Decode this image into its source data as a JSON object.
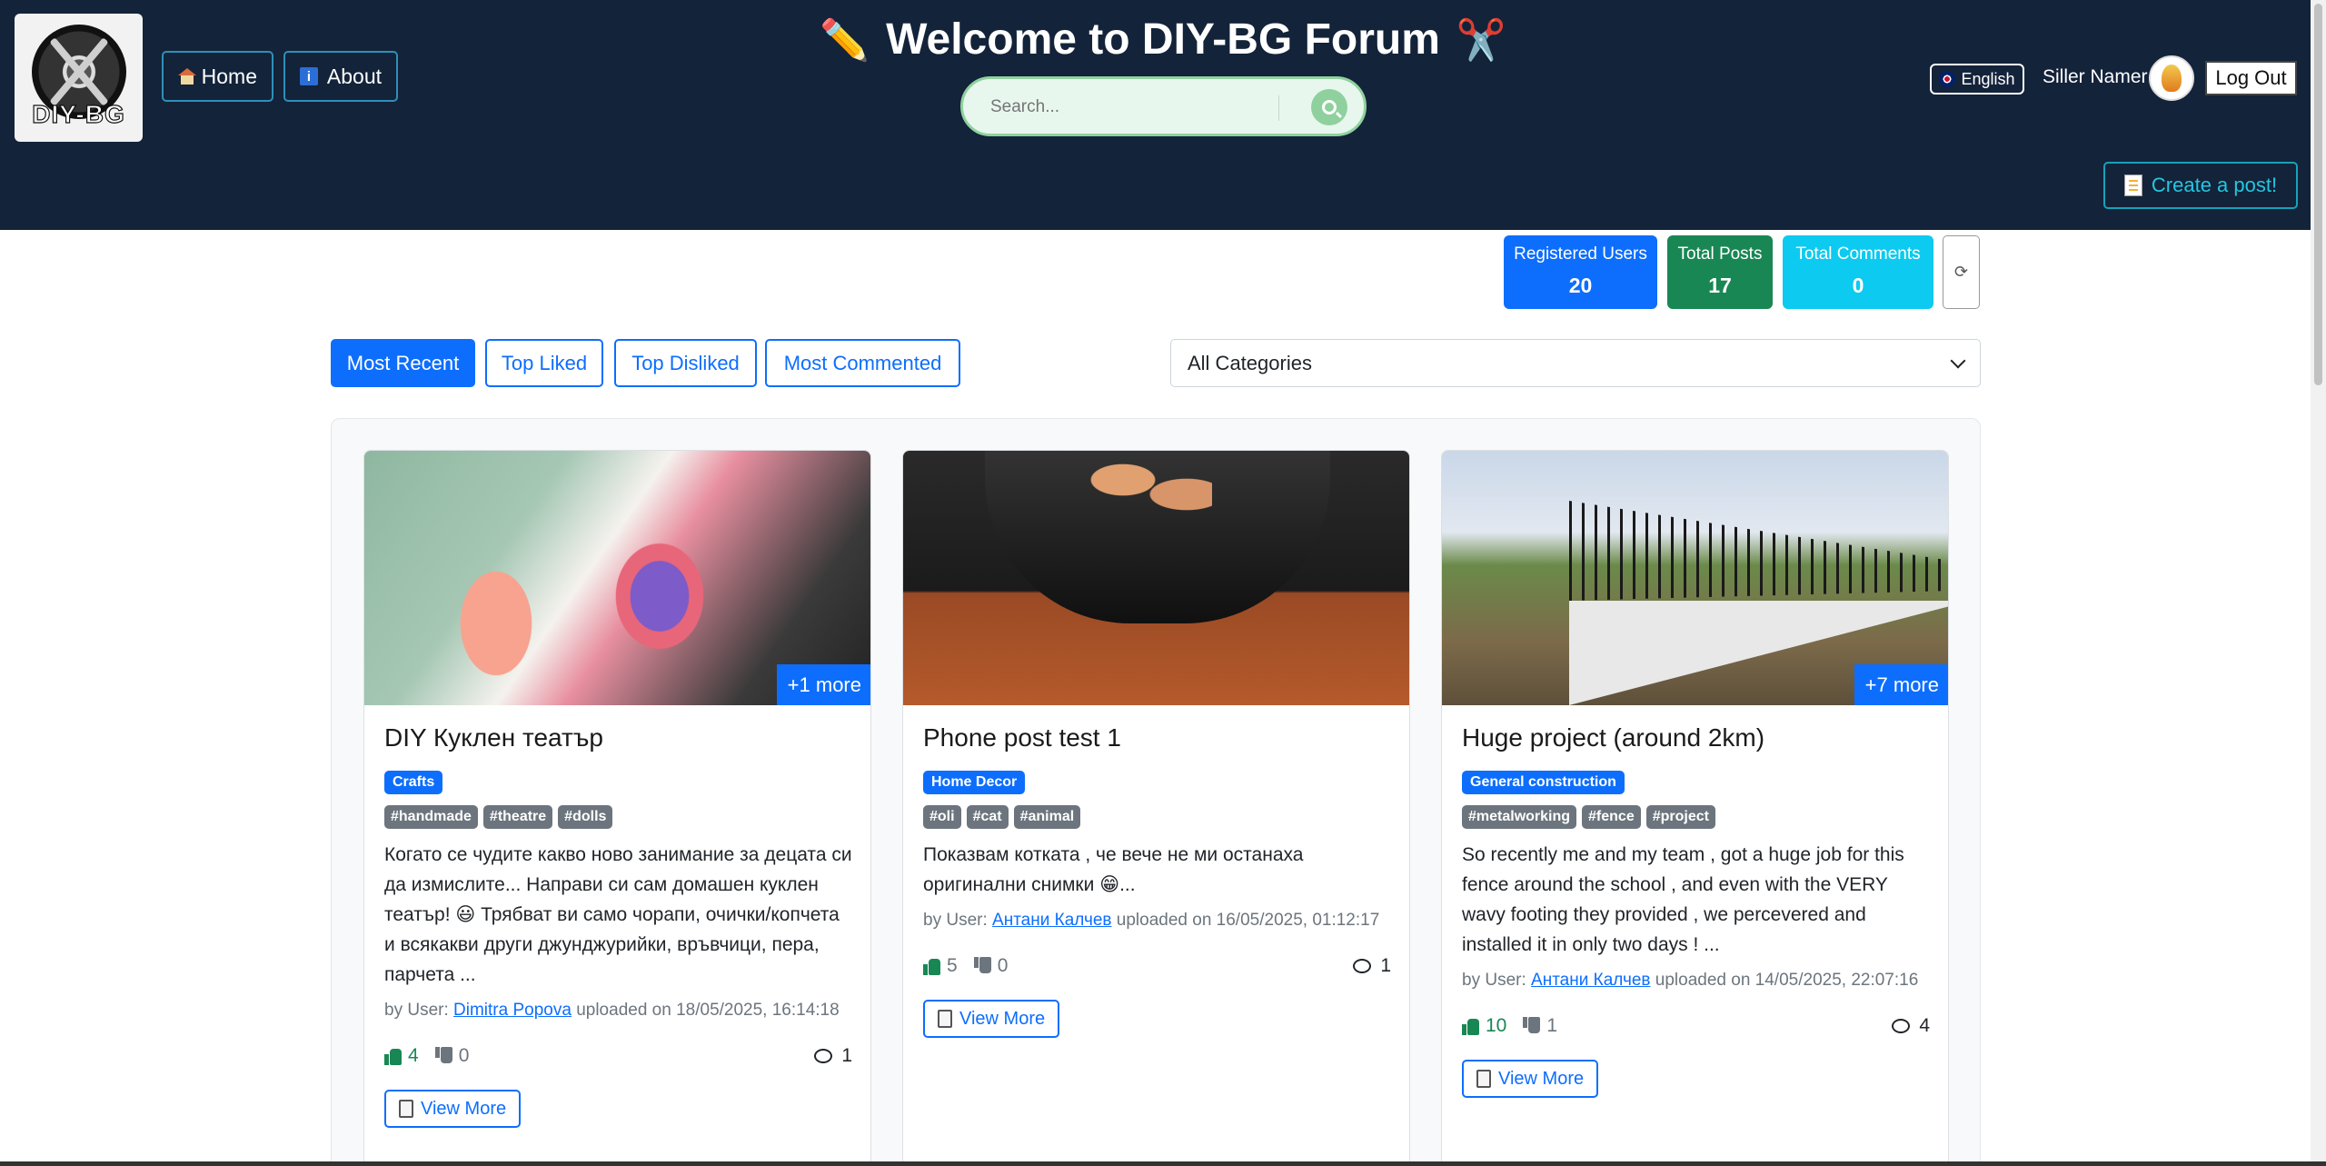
{
  "header": {
    "logo_text": "DIY-BG",
    "title": "Welcome to DIY-BG Forum",
    "title_left_icon": "✏️",
    "title_right_icon": "✂️",
    "nav": [
      {
        "label": "Home",
        "icon": "house-icon"
      },
      {
        "label": "About",
        "icon": "info-icon"
      }
    ],
    "search": {
      "placeholder": "Search..."
    },
    "language": "English",
    "username": "Siller Namer",
    "logout_label": "Log Out",
    "create_post_label": "Create a post!"
  },
  "stats": {
    "users_label": "Registered Users",
    "users_value": "20",
    "posts_label": "Total Posts",
    "posts_value": "17",
    "comments_label": "Total Comments",
    "comments_value": "0",
    "refresh_glyph": "⟳"
  },
  "filters": {
    "tabs": [
      "Most Recent",
      "Top Liked",
      "Top Disliked",
      "Most Commented"
    ],
    "active_tab": "Most Recent",
    "category_selected": "All Categories"
  },
  "posts": [
    {
      "title": "DIY Куклен театър",
      "more_badge": "+1 more",
      "category": "Crafts",
      "tags": [
        "#handmade",
        "#theatre",
        "#dolls"
      ],
      "description": "Когато се чудите какво ново занимание за децата си да измислите... Направи си сам домашен куклен театър! 😃 Трябват ви само чорапи, очички/копчета и всякакви други джунджурийки, връвчици, пера, парчета ...",
      "by_label": "by User:",
      "author": "Dimitra Popova",
      "uploaded": "uploaded on 18/05/2025, 16:14:18",
      "likes": "4",
      "dislikes": "0",
      "comments": "1",
      "view_more": "View More"
    },
    {
      "title": "Phone post test 1",
      "more_badge": "",
      "category": "Home Decor",
      "tags": [
        "#oli",
        "#cat",
        "#animal"
      ],
      "description": "Показвам котката , че вече не ми останаха оригинални снимки 😁...",
      "by_label": "by User:",
      "author": "Антани Калчев",
      "uploaded": "uploaded on 16/05/2025, 01:12:17",
      "likes": "5",
      "dislikes": "0",
      "comments": "1",
      "view_more": "View More"
    },
    {
      "title": "Huge project (around 2km)",
      "more_badge": "+7 more",
      "category": "General construction",
      "tags": [
        "#metalworking",
        "#fence",
        "#project"
      ],
      "description": "So recently me and my team , got a huge job for this fence around the school , and even with the VERY wavy footing they provided , we percevered and installed it in only two days ! ...",
      "by_label": "by User:",
      "author": "Антани Калчев",
      "uploaded": "uploaded on 14/05/2025, 22:07:16",
      "likes": "10",
      "dislikes": "1",
      "comments": "4",
      "view_more": "View More"
    }
  ],
  "colors": {
    "header_bg": "#13233a",
    "primary": "#0d6efd",
    "success": "#198754",
    "info": "#0dcaf0",
    "search_accent": "#8fd19e"
  }
}
